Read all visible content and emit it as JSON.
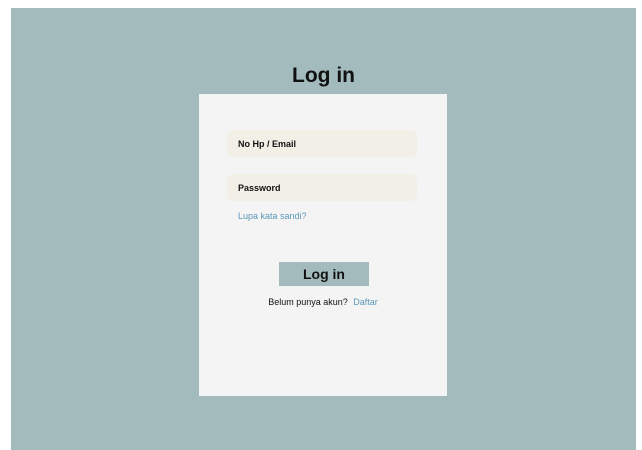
{
  "page": {
    "title": "Log in"
  },
  "form": {
    "email_placeholder": "No Hp / Email",
    "email_value": "",
    "password_placeholder": "Password",
    "password_value": "",
    "forgot_label": "Lupa kata sandi?",
    "login_label": "Log in",
    "register_prompt": "Belum punya akun?",
    "register_label": "Daftar"
  },
  "colors": {
    "background": "#a3bbbc",
    "card": "#f4f4f4",
    "field": "#f2efe6",
    "link": "#5a97b8",
    "button": "#a3bbbc"
  }
}
